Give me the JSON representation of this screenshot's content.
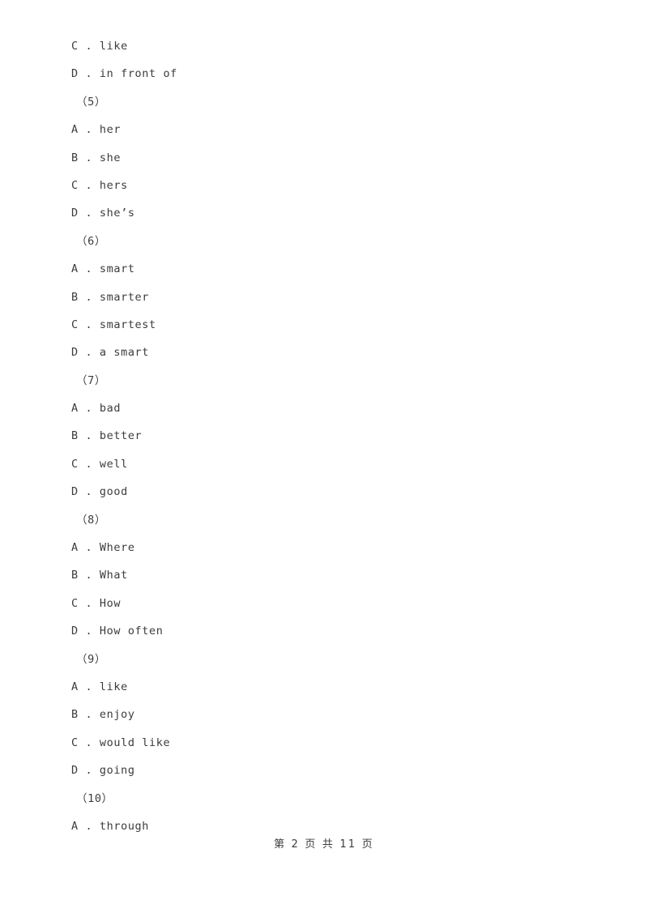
{
  "document": {
    "type": "exam-worksheet",
    "language": "en-zh",
    "page_number": 2,
    "total_pages": 11
  },
  "lines": [
    {
      "kind": "option",
      "text": "C . like"
    },
    {
      "kind": "option",
      "text": "D . in front of"
    },
    {
      "kind": "question",
      "text": "（5）"
    },
    {
      "kind": "option",
      "text": "A . her"
    },
    {
      "kind": "option",
      "text": "B . she"
    },
    {
      "kind": "option",
      "text": "C . hers"
    },
    {
      "kind": "option",
      "text": "D . she’s"
    },
    {
      "kind": "question",
      "text": "（6）"
    },
    {
      "kind": "option",
      "text": "A . smart"
    },
    {
      "kind": "option",
      "text": "B . smarter"
    },
    {
      "kind": "option",
      "text": "C . smartest"
    },
    {
      "kind": "option",
      "text": "D . a smart"
    },
    {
      "kind": "question",
      "text": "（7）"
    },
    {
      "kind": "option",
      "text": "A . bad"
    },
    {
      "kind": "option",
      "text": "B . better"
    },
    {
      "kind": "option",
      "text": "C . well"
    },
    {
      "kind": "option",
      "text": "D . good"
    },
    {
      "kind": "question",
      "text": "（8）"
    },
    {
      "kind": "option",
      "text": "A . Where"
    },
    {
      "kind": "option",
      "text": "B . What"
    },
    {
      "kind": "option",
      "text": "C . How"
    },
    {
      "kind": "option",
      "text": "D . How often"
    },
    {
      "kind": "question",
      "text": "（9）"
    },
    {
      "kind": "option",
      "text": "A . like"
    },
    {
      "kind": "option",
      "text": "B . enjoy"
    },
    {
      "kind": "option",
      "text": "C . would like"
    },
    {
      "kind": "option",
      "text": "D . going"
    },
    {
      "kind": "question",
      "text": "（10）"
    },
    {
      "kind": "option",
      "text": "A . through"
    }
  ],
  "footer": {
    "text": "第 2 页 共 11 页"
  },
  "colors": {
    "page_background": "#ffffff",
    "text": "#3c3c3c"
  }
}
